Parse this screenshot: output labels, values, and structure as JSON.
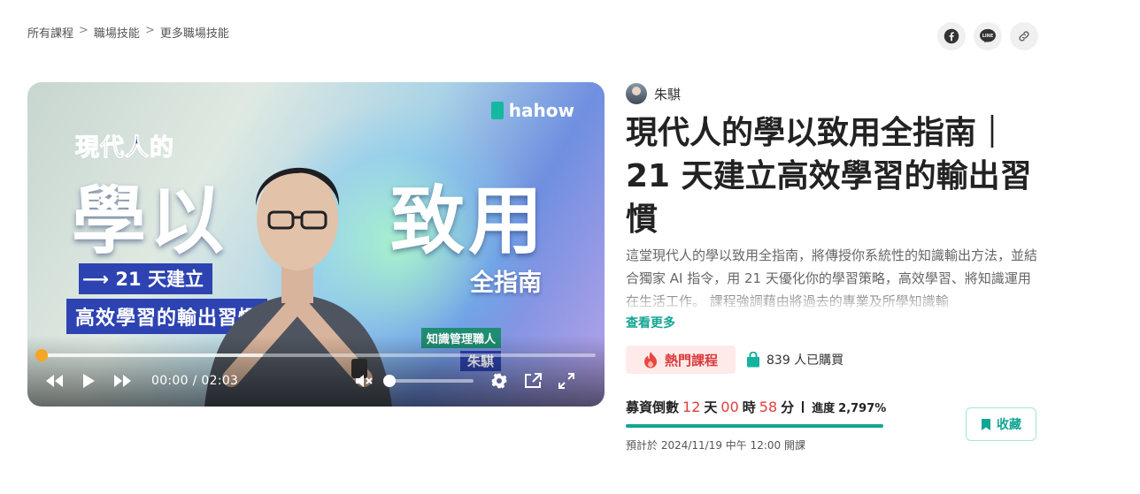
{
  "breadcrumb": {
    "items": [
      "所有課程",
      "職場技能",
      "更多職場技能"
    ],
    "separator": ">"
  },
  "share": {
    "icons": [
      "facebook-icon",
      "line-icon",
      "link-icon"
    ]
  },
  "video": {
    "brand": "hahow",
    "thumbnail": {
      "line1": "現代人的",
      "big1": "學以",
      "big2": "致用",
      "arrow_text": "⟶ 21 天建立",
      "box_text": "高效學習的輸出習慣",
      "side_text": "全指南",
      "role": "知識管理職人",
      "name": "朱騏"
    },
    "current_time": "00:00",
    "time_separator": "/",
    "duration": "02:03",
    "progress_fraction": 0.0,
    "buffered_fraction": 0.4,
    "volume_fraction": 0.0,
    "colors": {
      "progress_knob": "#f5a623"
    }
  },
  "course": {
    "instructor": "朱騏",
    "title": "現代人的學以致用全指南｜21 天建立高效學習的輸出習慣",
    "description": "這堂現代人的學以致用全指南，將傳授你系統性的知識輸出方法，並結合獨家 AI 指令，用 21 天優化你的學習策略，高效學習、將知識運用在生活工作。 課程強調藉由將過去的專業及所學知識輸",
    "see_more": "查看更多",
    "hot_label": "熱門課程",
    "buyers": "839 人已購買",
    "countdown": {
      "label": "募資倒數",
      "days": "12",
      "days_unit": "天",
      "hours": "00",
      "hours_unit": "時",
      "minutes": "58",
      "minutes_unit": "分",
      "progress_label": "進度",
      "progress_value": "2,797%"
    },
    "funding_fraction": 1.0,
    "start_text": "預計於 2024/11/19 中午 12:00 開課",
    "collect_label": "收藏"
  },
  "colors": {
    "accent": "#13a594",
    "hot_red": "#d93a3a",
    "countdown_red": "#e23c3c"
  }
}
